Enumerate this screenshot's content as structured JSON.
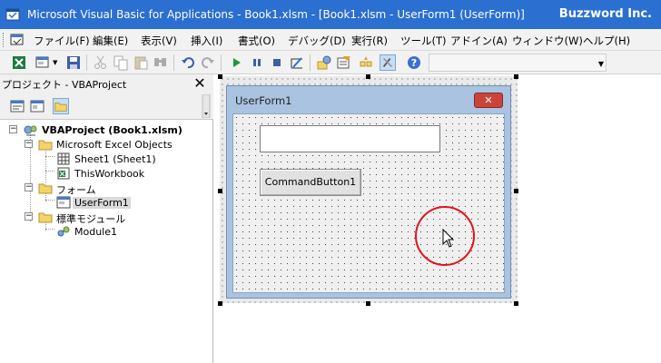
{
  "window": {
    "title": "Microsoft Visual Basic for Applications - Book1.xlsm - [Book1.xlsm - UserForm1 (UserForm)]",
    "brand": "Buzzword Inc."
  },
  "menu": {
    "items": [
      "ファイル(F)",
      "編集(E)",
      "表示(V)",
      "挿入(I)",
      "書式(O)",
      "デバッグ(D)",
      "実行(R)",
      "ツール(T)",
      "アドイン(A)",
      "ウィンドウ(W)",
      "ヘルプ(H)"
    ]
  },
  "toolbar": {
    "icons": [
      "excel-icon",
      "insert-userform-icon",
      "save-icon",
      "cut-icon",
      "copy-icon",
      "paste-icon",
      "find-icon",
      "undo-icon",
      "redo-icon",
      "run-icon",
      "break-icon",
      "reset-icon",
      "design-mode-icon",
      "project-explorer-icon",
      "properties-icon",
      "object-browser-icon",
      "toolbox-icon",
      "help-icon"
    ],
    "position_text": ""
  },
  "project_panel": {
    "title": "プロジェクト - VBAProject",
    "close_glyph": "✕",
    "tree": [
      {
        "label": "VBAProject (Book1.xlsm)",
        "expander": "−",
        "bold": true
      },
      {
        "label": "Microsoft Excel Objects",
        "expander": "−"
      },
      {
        "label": "Sheet1 (Sheet1)"
      },
      {
        "label": "ThisWorkbook"
      },
      {
        "label": "フォーム",
        "expander": "−"
      },
      {
        "label": "UserForm1",
        "selected": true
      },
      {
        "label": "標準モジュール",
        "expander": "−"
      },
      {
        "label": "Module1"
      }
    ]
  },
  "userform": {
    "caption": "UserForm1",
    "close_glyph": "✕",
    "command_button_label": "CommandButton1",
    "textbox_value": ""
  },
  "colors": {
    "titlebar": "#2b6fd1",
    "form_frame": "#a9c3e1",
    "highlight_circle": "#e0141b"
  }
}
